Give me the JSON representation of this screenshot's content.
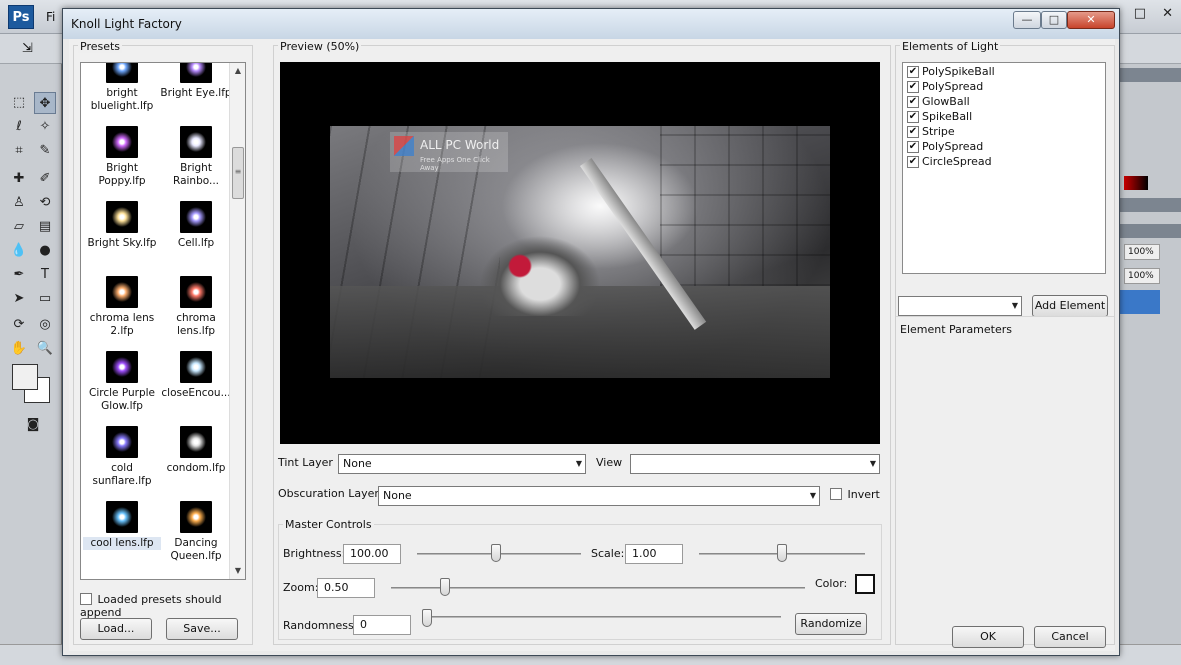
{
  "photoshop": {
    "logo": "Ps",
    "menu_first": "Fi",
    "win_min": "—",
    "win_restore": "□",
    "win_close": "✕",
    "zoom_1": "100%",
    "zoom_2": "100%"
  },
  "dialog": {
    "title": "Knoll Light Factory",
    "min_label": "—",
    "max_label": "□",
    "close_label": "✕"
  },
  "presets": {
    "label": "Presets",
    "items": [
      {
        "name": "bright bluelight.lfp",
        "color": "#6fa8ff"
      },
      {
        "name": "Bright Eye.lfp",
        "color": "#b88cff"
      },
      {
        "name": "Bright Poppy.lfp",
        "color": "#d26cff"
      },
      {
        "name": "Bright Rainbo...",
        "color": "#e8e8ff"
      },
      {
        "name": "Bright Sky.lfp",
        "color": "#ffe29a"
      },
      {
        "name": "Cell.lfp",
        "color": "#a79cff"
      },
      {
        "name": "chroma lens 2.lfp",
        "color": "#ffb070"
      },
      {
        "name": "chroma lens.lfp",
        "color": "#ff7a6a"
      },
      {
        "name": "Circle Purple Glow.lfp",
        "color": "#a050ff"
      },
      {
        "name": "closeEncou...",
        "color": "#c8e8ff"
      },
      {
        "name": "cold sunflare.lfp",
        "color": "#8a7cff"
      },
      {
        "name": "condom.lfp",
        "color": "#e0e0e0"
      },
      {
        "name": "cool lens.lfp",
        "color": "#6ac4ff"
      },
      {
        "name": "Dancing Queen.lfp",
        "color": "#ffb050"
      }
    ],
    "append_label": "Loaded presets should append",
    "load_label": "Load...",
    "save_label": "Save..."
  },
  "preview": {
    "label": "Preview (50%)",
    "watermark_title": "ALL PC World",
    "watermark_sub": "Free Apps One Click Away",
    "tint_label": "Tint Layer",
    "tint_value": "None",
    "view_label": "View",
    "view_value": "",
    "obscuration_label": "Obscuration Layer",
    "obscuration_value": "None",
    "invert_label": "Invert"
  },
  "master": {
    "label": "Master Controls",
    "brightness_label": "Brightness:",
    "brightness_value": "100.00",
    "brightness_level": 0.48,
    "scale_label": "Scale:",
    "scale_value": "1.00",
    "scale_level": 0.5,
    "zoom_label": "Zoom:",
    "zoom_value": "0.50",
    "zoom_level": 0.13,
    "color_label": "Color:",
    "randomness_label": "Randomness:",
    "randomness_value": "0",
    "randomness_level": 0.0,
    "randomize_label": "Randomize"
  },
  "elements": {
    "label": "Elements of Light",
    "items": [
      {
        "name": "PolySpikeBall",
        "checked": true
      },
      {
        "name": "PolySpread",
        "checked": true
      },
      {
        "name": "GlowBall",
        "checked": true
      },
      {
        "name": "SpikeBall",
        "checked": true
      },
      {
        "name": "Stripe",
        "checked": true
      },
      {
        "name": "PolySpread",
        "checked": true
      },
      {
        "name": "CircleSpread",
        "checked": true
      }
    ],
    "element_select_value": "",
    "add_element_label": "Add Element",
    "params_label": "Element Parameters",
    "ok_label": "OK",
    "cancel_label": "Cancel"
  }
}
